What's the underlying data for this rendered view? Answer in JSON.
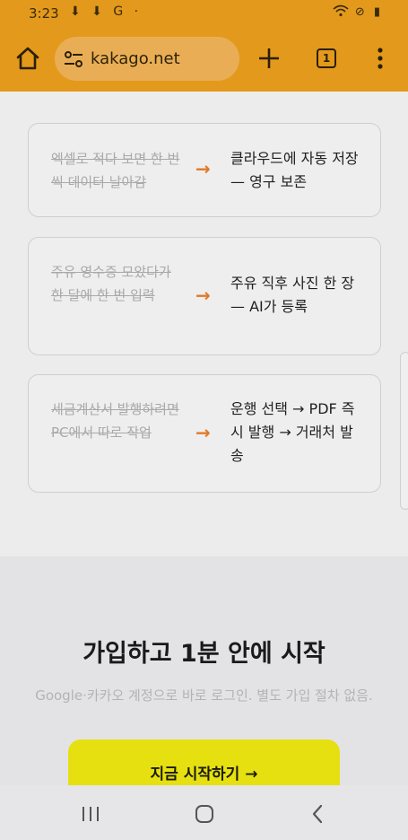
{
  "status_bar": {
    "time": "3:23",
    "notif_icons": [
      "download-icon",
      "download-icon",
      "google-icon",
      "dot-icon"
    ],
    "notif_glyphs": "⬇ ⬇ G ·",
    "sys_glyphs": "⊘ ▮",
    "sys_icons": [
      "wifi-icon",
      "dnd-icon",
      "battery-icon"
    ]
  },
  "browser": {
    "url": "kakago.net",
    "tab_count": "1",
    "theme_color": "#e3991b"
  },
  "cards": [
    {
      "old": "엑셀로 적다 보면 한 번씩 데이터 날아감",
      "arrow": "→",
      "new": "클라우드에 자동 저장 — 영구 보존"
    },
    {
      "old": "주유 영수증 모았다가 한 달에 한 번 입력",
      "arrow": "→",
      "new": "주유 직후 사진 한 장 — AI가 등록"
    },
    {
      "old": "세금계산서 발행하려면 PC에서 따로 작업",
      "arrow": "→",
      "new": "운행 선택 → PDF 즉시 발행 → 거래처 발송"
    }
  ],
  "cta": {
    "title": "가입하고 1분 안에 시작",
    "subtitle": "Google·카카오 계정으로 바로 로그인. 별도 가입 절차 없음.",
    "button_label": "지금 시작하기 →",
    "button_color": "#e6e011"
  },
  "nav": {
    "icons": [
      "recents-icon",
      "home-icon",
      "back-icon"
    ]
  }
}
